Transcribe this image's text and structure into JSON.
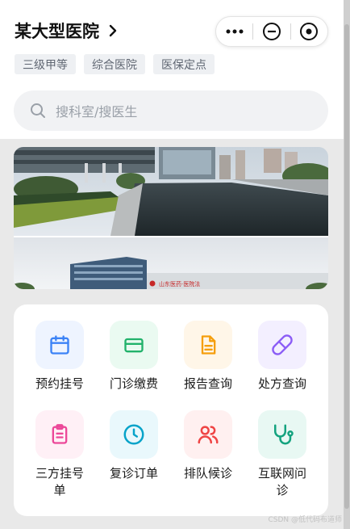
{
  "header": {
    "hospital_name": "某大型医院",
    "tags": [
      "三级甲等",
      "综合医院",
      "医保定点"
    ]
  },
  "search": {
    "placeholder": "搜科室/搜医生"
  },
  "services": [
    {
      "label": "预约挂号",
      "icon": "calendar-icon",
      "color": "#3b82f6",
      "bg": "#eef4ff"
    },
    {
      "label": "门诊缴费",
      "icon": "credit-card-icon",
      "color": "#22b26b",
      "bg": "#eafaf1"
    },
    {
      "label": "报告查询",
      "icon": "document-icon",
      "color": "#f59e0b",
      "bg": "#fff6e8"
    },
    {
      "label": "处方查询",
      "icon": "pill-icon",
      "color": "#8b5cf6",
      "bg": "#f3efff"
    },
    {
      "label": "三方挂号单",
      "icon": "clipboard-icon",
      "color": "#ec4899",
      "bg": "#fff0f6"
    },
    {
      "label": "复诊订单",
      "icon": "clock-icon",
      "color": "#06a3c9",
      "bg": "#e9f8fc"
    },
    {
      "label": "排队候诊",
      "icon": "users-icon",
      "color": "#ef4444",
      "bg": "#fff0f0"
    },
    {
      "label": "互联网问诊",
      "icon": "stethoscope-icon",
      "color": "#14a37f",
      "bg": "#e8f8f3"
    }
  ],
  "banner": {
    "sign_text": "山东医药·医院法"
  },
  "watermark": "CSDN @低代码布道师"
}
